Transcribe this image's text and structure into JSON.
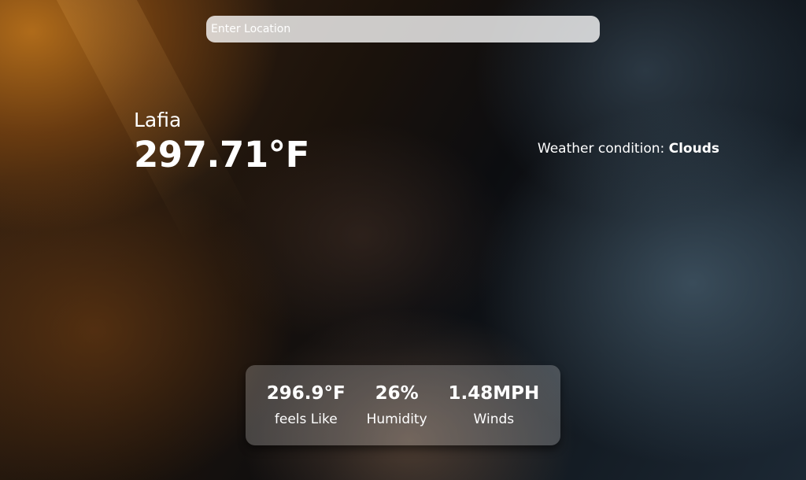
{
  "search": {
    "placeholder": "Enter Location",
    "value": ""
  },
  "weather": {
    "location": "Lafia",
    "temperature": "297.71°F",
    "condition_label": "Weather condition:",
    "condition_value": "Clouds"
  },
  "details": {
    "feels_like": {
      "value": "296.9°F",
      "label": "feels Like"
    },
    "humidity": {
      "value": "26%",
      "label": "Humidity"
    },
    "winds": {
      "value": "1.48MPH",
      "label": "Winds"
    }
  },
  "background": {
    "description_tag": "cloudy-sunset-sky",
    "colors": {
      "warm": "#c4781c",
      "dark": "#0c0d10",
      "cool": "#465c6c"
    }
  }
}
